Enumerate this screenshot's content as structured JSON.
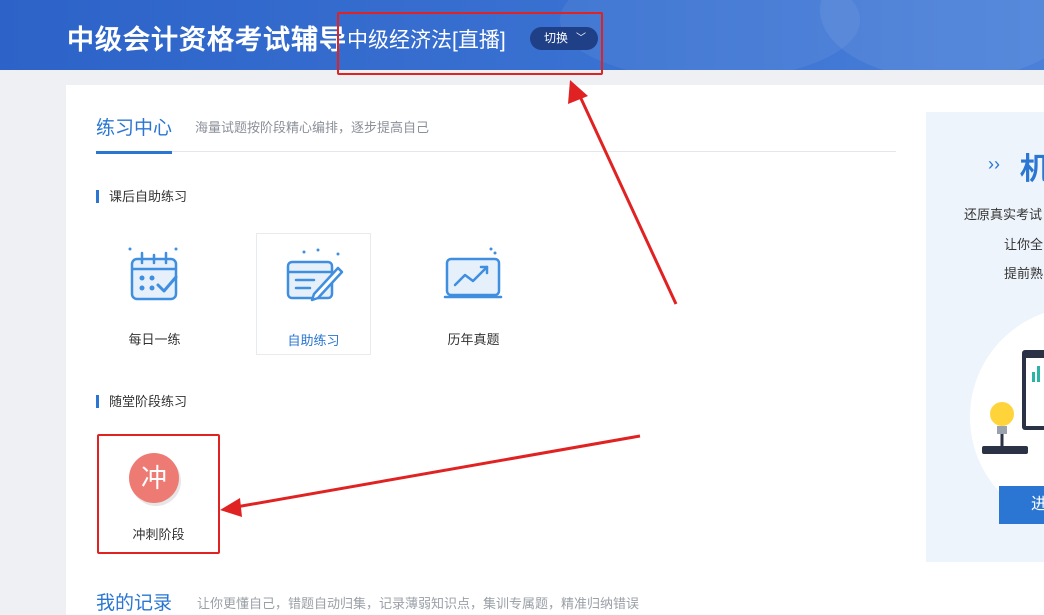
{
  "header": {
    "brand": "中级会计资格考试辅导",
    "course": "中级经济法[直播]",
    "switch_label": "切换"
  },
  "practice": {
    "tab_title": "练习中心",
    "tab_subtitle": "海量试题按阶段精心编排，逐步提高自己",
    "after_class": {
      "title": "课后自助练习",
      "items": [
        {
          "label": "每日一练",
          "icon": "calendar-icon"
        },
        {
          "label": "自助练习",
          "icon": "edit-form-icon"
        },
        {
          "label": "历年真题",
          "icon": "chart-board-icon"
        }
      ]
    },
    "stage": {
      "title": "随堂阶段练习",
      "items": [
        {
          "label": "冲刺阶段",
          "badge": "冲"
        }
      ]
    }
  },
  "bottom": {
    "title": "我的记录",
    "subtitle": "让你更懂自己，错题自动归集，记录薄弱知识点，集训专属题，精准归纳错误"
  },
  "side_panel": {
    "arrow": "››",
    "title": "机",
    "lines": [
      "还原真实考试",
      "让你全",
      "提前熟"
    ],
    "button": "进"
  },
  "colors": {
    "header_blue": "#2d63c8",
    "accent": "#2a76d2",
    "badge_red": "#ee7b73",
    "annotation_red": "#e02222"
  }
}
